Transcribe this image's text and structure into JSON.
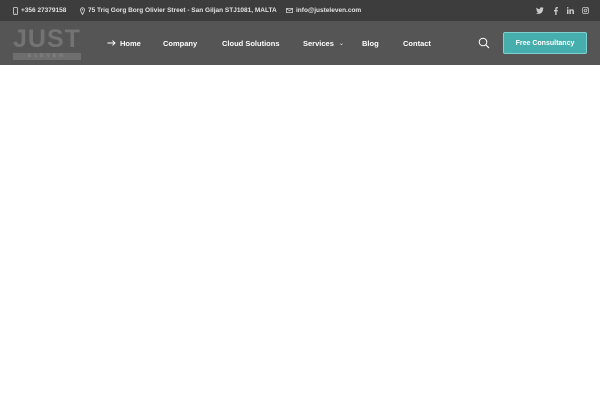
{
  "topbar": {
    "phone": "+356 27379158",
    "address": "75 Triq Gorg Borg Olivier Street - San Giljan STJ1081, MALTA",
    "email": "info@justeleven.com",
    "social": [
      "twitter-icon",
      "facebook-icon",
      "linkedin-icon",
      "instagram-icon"
    ]
  },
  "logo": {
    "text": "JUST",
    "subtext": "ELEVEN"
  },
  "nav": {
    "items": [
      "Home",
      "Company",
      "Cloud Solutions",
      "Services",
      "Blog",
      "Contact"
    ],
    "active": "Home",
    "cta_label": "Free Consultancy"
  },
  "colors": {
    "topbar_bg": "#3d3d3d",
    "navbar_bg": "#555555",
    "cta_bg": "#46aeac",
    "page_bg": "#ffffff"
  }
}
